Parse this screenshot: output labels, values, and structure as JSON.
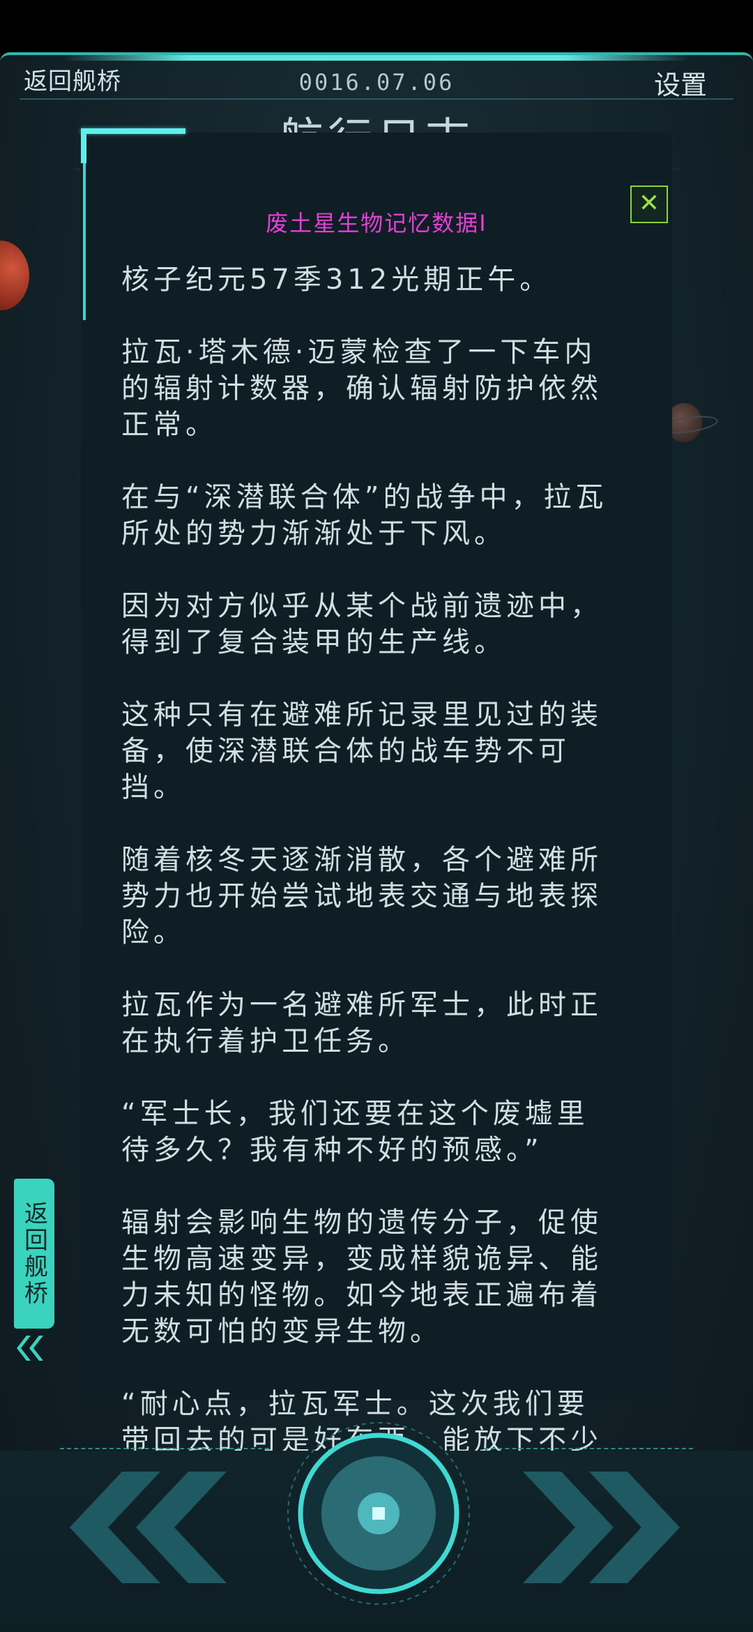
{
  "header": {
    "back_label": "返回舰桥",
    "date": "0016.07.06",
    "settings_label": "设置",
    "title": "航行日志"
  },
  "log": {
    "title": "废土星生物记忆数据I",
    "close_glyph": "✕",
    "paragraphs": [
      "核子纪元57季312光期正午。",
      "拉瓦·塔木德·迈蒙检查了一下车内的辐射计数器，确认辐射防护依然正常。",
      "在与“深潜联合体”的战争中，拉瓦所处的势力渐渐处于下风。",
      "因为对方似乎从某个战前遗迹中，得到了复合装甲的生产线。",
      "这种只有在避难所记录里见过的装备，使深潜联合体的战车势不可挡。",
      "随着核冬天逐渐消散，各个避难所势力也开始尝试地表交通与地表探险。",
      "拉瓦作为一名避难所军士，此时正在执行着护卫任务。",
      "“军士长，我们还要在这个废墟里待多久？我有种不好的预感。”",
      "辐射会影响生物的遗传分子，促使生物高速变异，变成样貌诡异、能力未知的怪物。如今地表正遍布着无数可怕的变异生物。",
      "“耐心点，拉瓦军士。这次我们要带回去的可是好东西，能放下不少"
    ]
  },
  "side_tab": {
    "label": "返回舰桥"
  },
  "colors": {
    "accent_cyan": "#5ef0ec",
    "title_magenta": "#e63fd8",
    "close_green": "#9be04a",
    "tab_teal": "#3ad3be"
  },
  "icons": {
    "prev": "double-chevron-left-icon",
    "next": "double-chevron-right-icon",
    "center": "record-button-icon",
    "close": "close-icon",
    "side": "double-arrow-left-icon"
  }
}
